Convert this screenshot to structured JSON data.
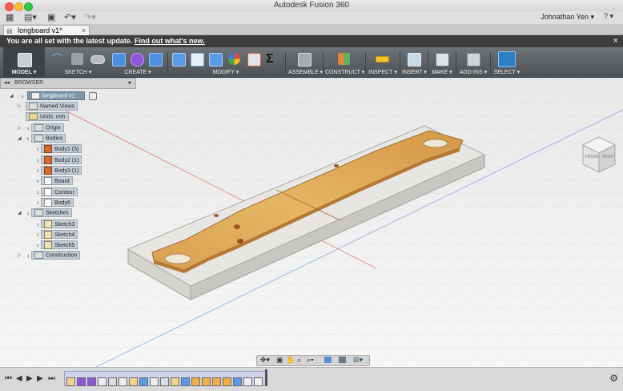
{
  "window": {
    "title": "Autodesk Fusion 360",
    "traffic_lights": [
      "#fc5f57",
      "#fdbc2e",
      "#33c748"
    ]
  },
  "appbar": {
    "user": "Johnathan Yen ▾",
    "help": "? ▾"
  },
  "tab": {
    "label": "longboard v1*",
    "close": "×"
  },
  "notice": {
    "text": "You are all set with the latest update.",
    "link": "Find out what's new.",
    "close": "×"
  },
  "toolbar": {
    "groups": [
      {
        "label": "MODEL ▾"
      },
      {
        "label": "SKETCH ▾"
      },
      {
        "label": "CREATE ▾"
      },
      {
        "label": "MODIFY ▾"
      },
      {
        "label": "ASSEMBLE ▾"
      },
      {
        "label": "CONSTRUCT ▾"
      },
      {
        "label": "INSPECT ▾"
      },
      {
        "label": "INSERT ▾"
      },
      {
        "label": "MAKE ▾"
      },
      {
        "label": "ADD-INS ▾"
      },
      {
        "label": "SELECT ▾"
      }
    ],
    "sigma": "Σ"
  },
  "browser": {
    "title": "BROWSER",
    "root": "longboard v1",
    "rows": [
      {
        "label": "Named Views"
      },
      {
        "label": "Units: mm"
      },
      {
        "label": "Origin"
      },
      {
        "label": "Bodies"
      },
      {
        "label": "Body1 (5)"
      },
      {
        "label": "Body2 (1)"
      },
      {
        "label": "Body3 (1)"
      },
      {
        "label": "Board"
      },
      {
        "label": "Contour"
      },
      {
        "label": "Body6"
      },
      {
        "label": "Sketches"
      },
      {
        "label": "Sketch3"
      },
      {
        "label": "Sketch4"
      },
      {
        "label": "Sketch5"
      },
      {
        "label": "Construction"
      }
    ]
  },
  "viewcube": {
    "front": "FRONT",
    "right": "RIGHT"
  },
  "timeline": {
    "controls": [
      "⏮",
      "◀",
      "▶",
      "▶",
      "⏭"
    ],
    "settings": "⚙"
  }
}
